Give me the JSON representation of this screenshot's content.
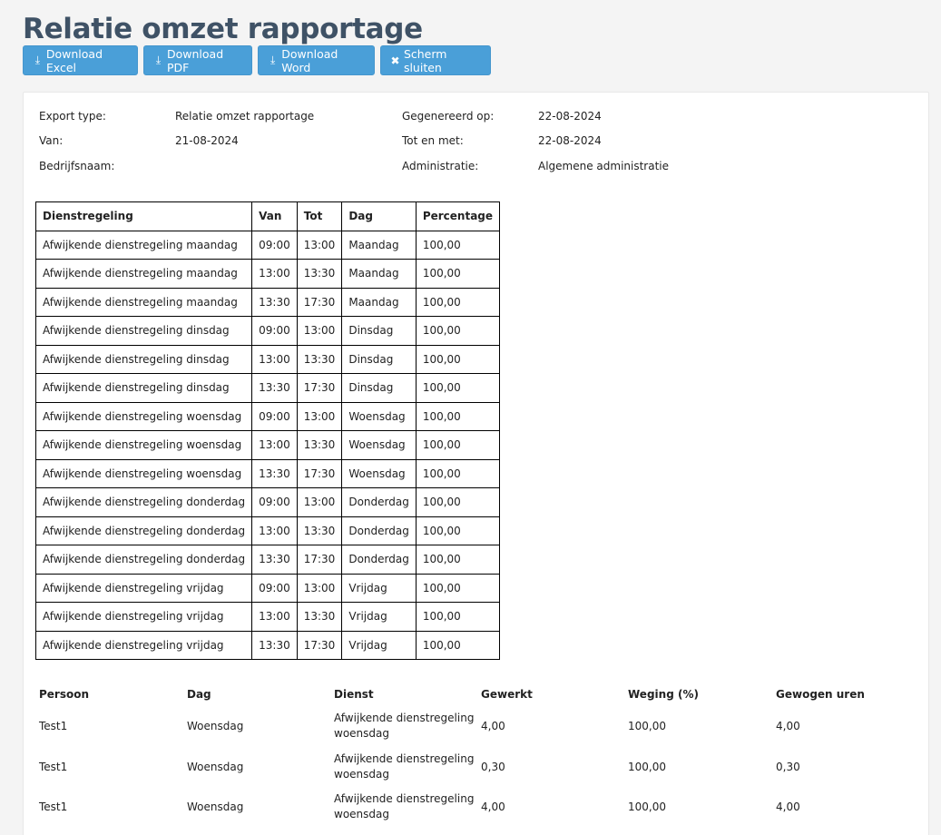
{
  "page": {
    "title": "Relatie omzet rapportage"
  },
  "toolbar": {
    "download_excel": "Download Excel",
    "download_pdf": "Download PDF",
    "download_word": "Download Word",
    "close_screen": "Scherm sluiten"
  },
  "meta": {
    "export_type_label": "Export type:",
    "export_type_value": "Relatie omzet rapportage",
    "generated_label": "Gegenereerd op:",
    "generated_value": "22-08-2024",
    "from_label": "Van:",
    "from_value": "21-08-2024",
    "until_label": "Tot en met:",
    "until_value": "22-08-2024",
    "company_label": "Bedrijfsnaam:",
    "company_value": "",
    "administration_label": "Administratie:",
    "administration_value": "Algemene administratie"
  },
  "schedule": {
    "headers": [
      "Dienstregeling",
      "Van",
      "Tot",
      "Dag",
      "Percentage"
    ],
    "rows": [
      [
        "Afwijkende dienstregeling maandag",
        "09:00",
        "13:00",
        "Maandag",
        "100,00"
      ],
      [
        "Afwijkende dienstregeling maandag",
        "13:00",
        "13:30",
        "Maandag",
        "100,00"
      ],
      [
        "Afwijkende dienstregeling maandag",
        "13:30",
        "17:30",
        "Maandag",
        "100,00"
      ],
      [
        "Afwijkende dienstregeling dinsdag",
        "09:00",
        "13:00",
        "Dinsdag",
        "100,00"
      ],
      [
        "Afwijkende dienstregeling dinsdag",
        "13:00",
        "13:30",
        "Dinsdag",
        "100,00"
      ],
      [
        "Afwijkende dienstregeling dinsdag",
        "13:30",
        "17:30",
        "Dinsdag",
        "100,00"
      ],
      [
        "Afwijkende dienstregeling woensdag",
        "09:00",
        "13:00",
        "Woensdag",
        "100,00"
      ],
      [
        "Afwijkende dienstregeling woensdag",
        "13:00",
        "13:30",
        "Woensdag",
        "100,00"
      ],
      [
        "Afwijkende dienstregeling woensdag",
        "13:30",
        "17:30",
        "Woensdag",
        "100,00"
      ],
      [
        "Afwijkende dienstregeling donderdag",
        "09:00",
        "13:00",
        "Donderdag",
        "100,00"
      ],
      [
        "Afwijkende dienstregeling donderdag",
        "13:00",
        "13:30",
        "Donderdag",
        "100,00"
      ],
      [
        "Afwijkende dienstregeling donderdag",
        "13:30",
        "17:30",
        "Donderdag",
        "100,00"
      ],
      [
        "Afwijkende dienstregeling vrijdag",
        "09:00",
        "13:00",
        "Vrijdag",
        "100,00"
      ],
      [
        "Afwijkende dienstregeling vrijdag",
        "13:00",
        "13:30",
        "Vrijdag",
        "100,00"
      ],
      [
        "Afwijkende dienstregeling vrijdag",
        "13:30",
        "17:30",
        "Vrijdag",
        "100,00"
      ]
    ]
  },
  "summary": {
    "headers": [
      "Persoon",
      "Dag",
      "Dienst",
      "Gewerkt",
      "Weging (%)",
      "Gewogen uren"
    ],
    "rows": [
      [
        "Test1",
        "Woensdag",
        "Afwijkende dienstregeling woensdag",
        "4,00",
        "100,00",
        "4,00"
      ],
      [
        "Test1",
        "Woensdag",
        "Afwijkende dienstregeling woensdag",
        "0,30",
        "100,00",
        "0,30"
      ],
      [
        "Test1",
        "Woensdag",
        "Afwijkende dienstregeling woensdag",
        "4,00",
        "100,00",
        "4,00"
      ]
    ]
  },
  "icons": {
    "download": "download-icon",
    "close": "close-icon"
  },
  "colors": {
    "button": "#4a9fd8",
    "title": "#3f5266"
  }
}
